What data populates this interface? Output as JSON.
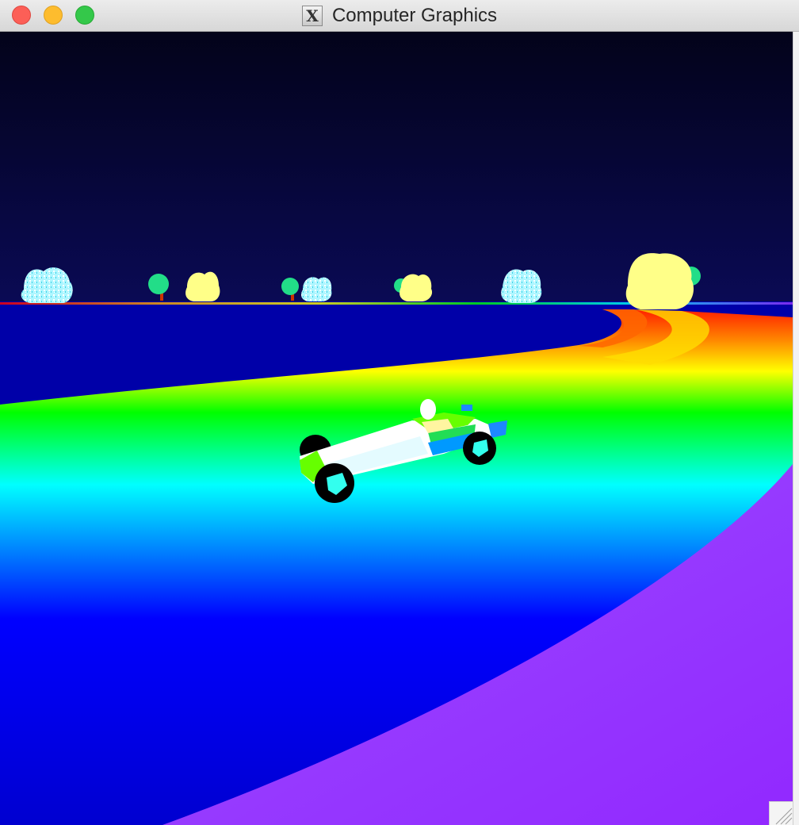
{
  "window": {
    "title": "Computer Graphics",
    "app_icon": "x11-icon",
    "app_icon_glyph": "X",
    "controls": [
      "close-button",
      "minimize-button",
      "zoom-button"
    ]
  },
  "scene": {
    "sky_colors": [
      "#03031a",
      "#0a0a55"
    ],
    "ground_color": "#0000a8",
    "track_colors": [
      "#ff2a00",
      "#ff9900",
      "#ffff00",
      "#00ff00",
      "#00ffff",
      "#0000ff"
    ],
    "outer_ground_color": "#9933ff",
    "car": {
      "body_color": "#ffffff",
      "trim_color": "#66ff00",
      "accent_color": "#0099ff",
      "wheel_color": "#000000",
      "hub_color": "#33ffee"
    },
    "scenery": [
      "cyan-bush",
      "green-tree",
      "yellow-bush",
      "green-tree",
      "cyan-bush",
      "yellow-bush",
      "cyan-bush",
      "yellow-bush"
    ]
  }
}
